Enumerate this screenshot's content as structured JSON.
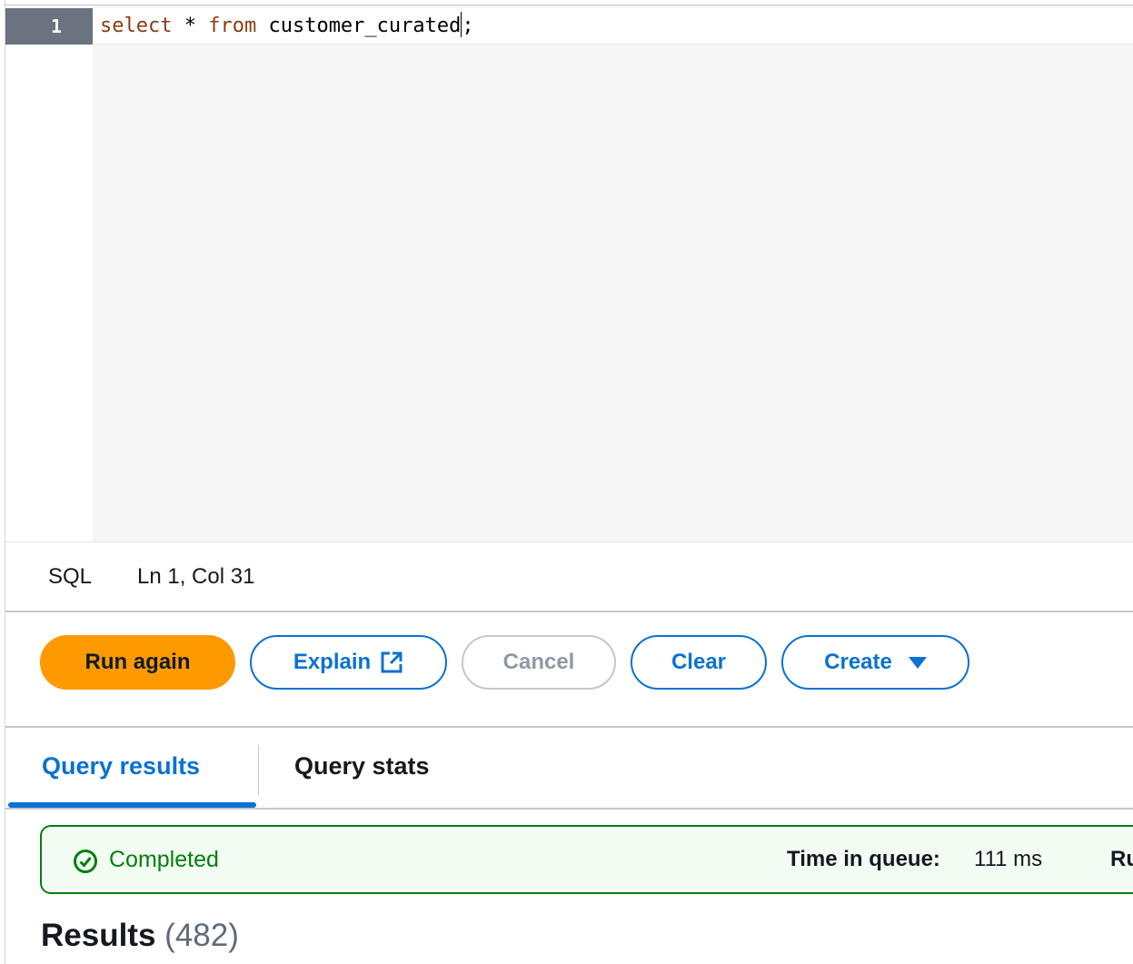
{
  "editor": {
    "line_number": "1",
    "code": {
      "kw1": "select",
      "t1": " * ",
      "kw2": "from",
      "t2": " customer_curated",
      "t3": ";"
    }
  },
  "status_bar": {
    "language": "SQL",
    "position": "Ln 1, Col 31"
  },
  "toolbar": {
    "run_again_label": "Run again",
    "explain_label": "Explain",
    "cancel_label": "Cancel",
    "clear_label": "Clear",
    "create_label": "Create"
  },
  "tabs": [
    {
      "label": "Query results",
      "active": true
    },
    {
      "label": "Query stats",
      "active": false
    }
  ],
  "query_status": {
    "state": "Completed",
    "time_in_queue_label": "Time in queue:",
    "time_in_queue_value": "111 ms",
    "run_time_label_partial": "Ru"
  },
  "results": {
    "title": "Results",
    "count": "(482)"
  },
  "colors": {
    "primary": "#ff9900",
    "link": "#0972d3",
    "success": "#037f0c",
    "keyword": "#8a3b12"
  }
}
